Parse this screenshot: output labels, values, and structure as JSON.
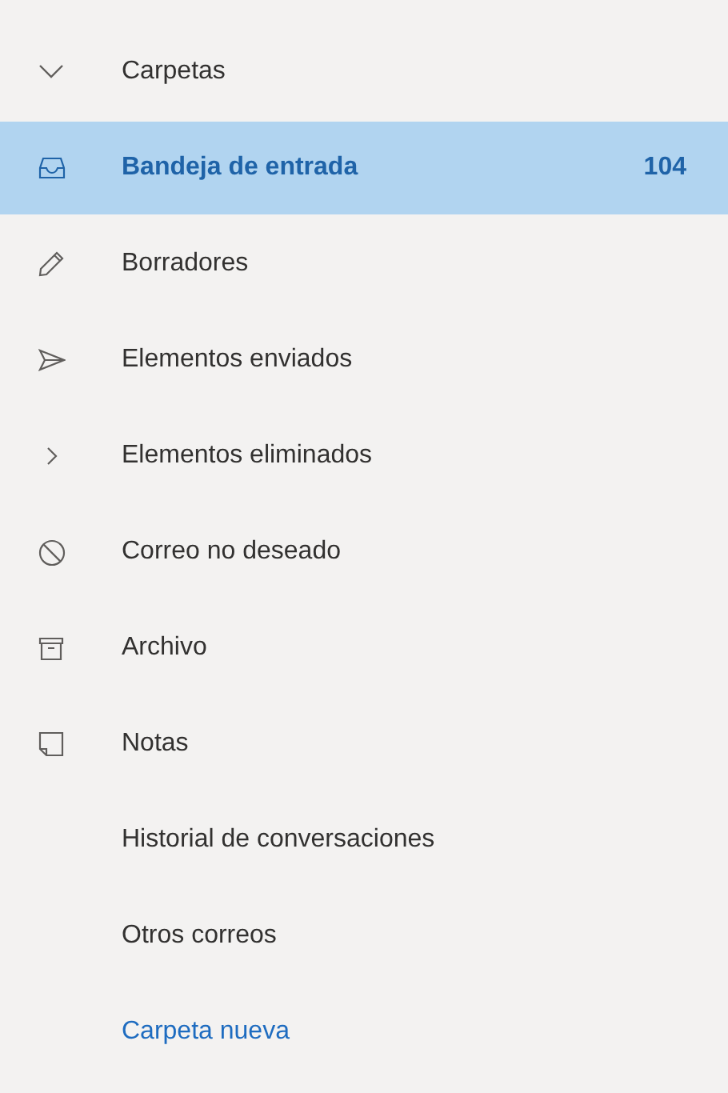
{
  "section": {
    "title": "Carpetas",
    "expanded": true
  },
  "folders": [
    {
      "kind": "inbox",
      "label": "Bandeja de entrada",
      "count": "104",
      "selected": true
    },
    {
      "kind": "drafts",
      "label": "Borradores",
      "selected": false
    },
    {
      "kind": "sent",
      "label": "Elementos enviados",
      "selected": false
    },
    {
      "kind": "deleted",
      "label": "Elementos eliminados",
      "selected": false
    },
    {
      "kind": "junk",
      "label": "Correo no deseado",
      "selected": false
    },
    {
      "kind": "archive",
      "label": "Archivo",
      "selected": false
    },
    {
      "kind": "notes",
      "label": "Notas",
      "selected": false
    },
    {
      "kind": "custom",
      "label": "Historial de conversaciones",
      "selected": false
    },
    {
      "kind": "custom",
      "label": "Otros correos",
      "selected": false
    }
  ],
  "new_folder_link": "Carpeta nueva"
}
